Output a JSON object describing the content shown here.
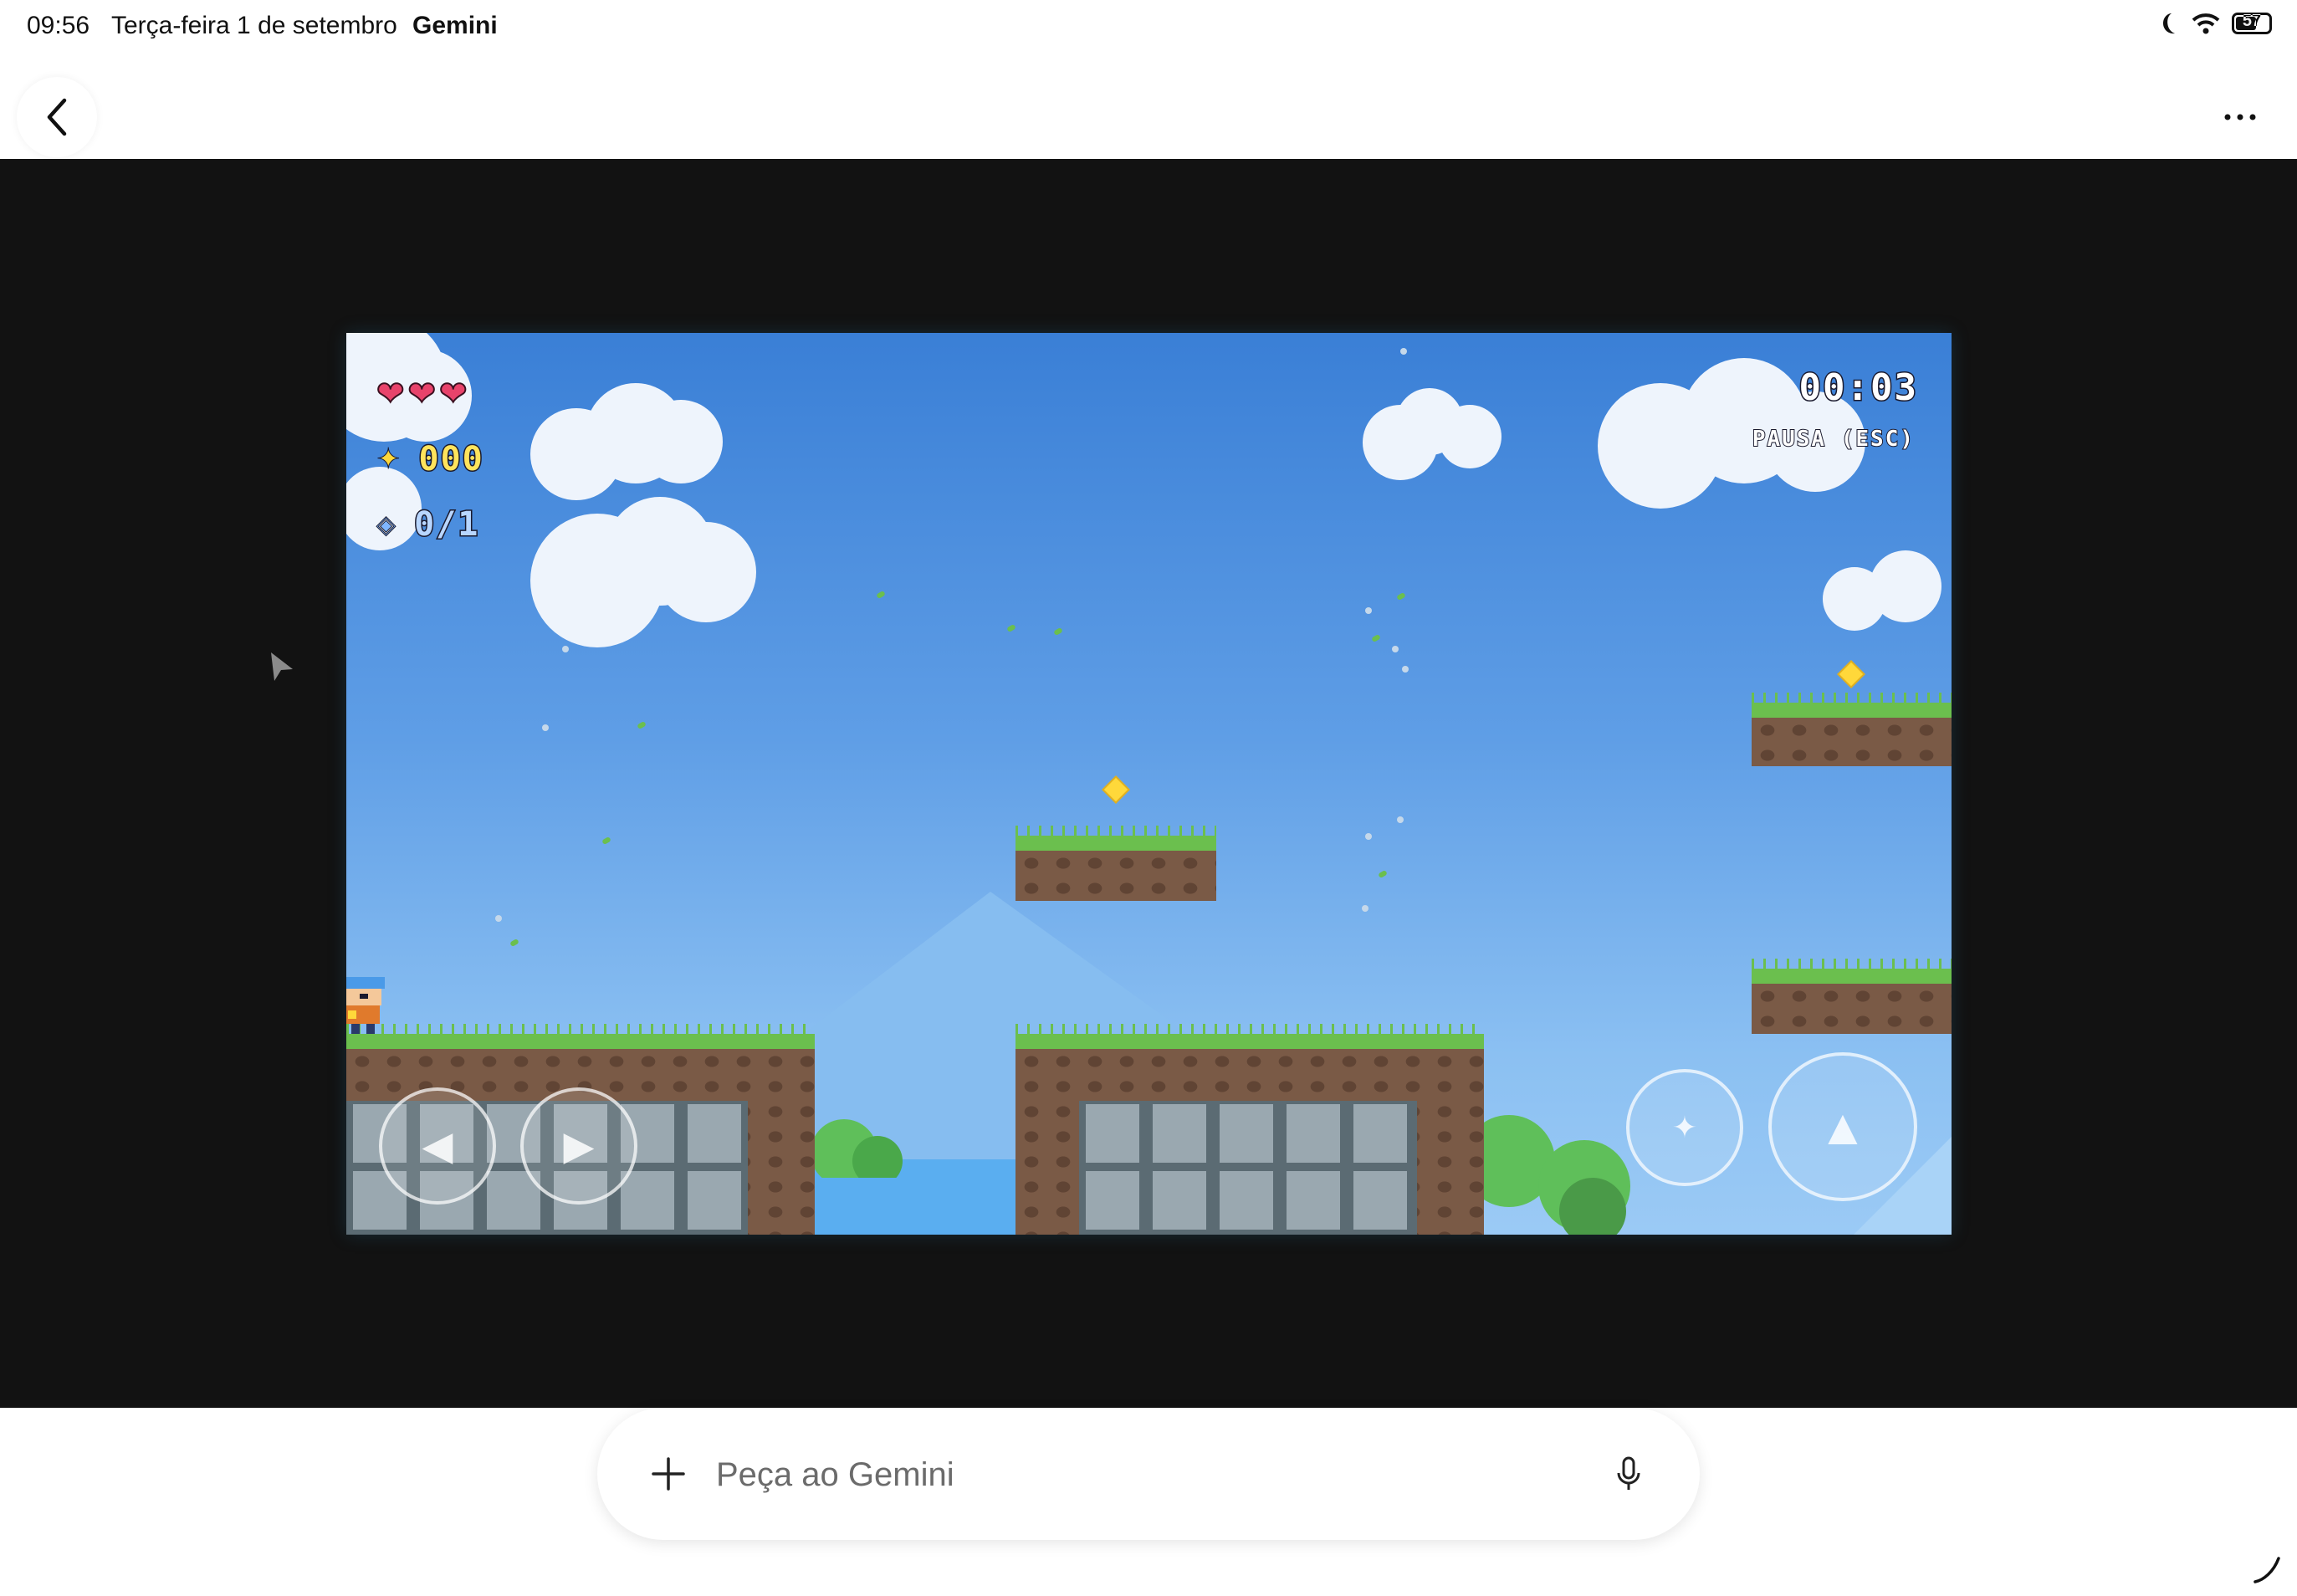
{
  "status_bar": {
    "time": "09:56",
    "date": "Terça-feira 1 de setembro",
    "app": "Gemini",
    "battery_level": "57"
  },
  "header": {
    "back_icon": "chevron-left-icon",
    "more_icon": "more-horizontal-icon"
  },
  "game": {
    "hearts": "❤❤❤",
    "coin_icon": "✦",
    "coins": "000",
    "gem_icon": "◈",
    "gems": "0/1",
    "timer": "00:03",
    "pause_hint": "PAUSA (ESC)",
    "controls": {
      "left": "◀",
      "right": "▶",
      "action": "✦",
      "jump": "▲"
    },
    "colors": {
      "sky_top": "#3a7fd6",
      "sky_bottom": "#9bcaf5",
      "grass": "#6bbf4e",
      "dirt": "#7a5a46",
      "coin": "#ffd83a",
      "heart": "#e8436b"
    }
  },
  "prompt": {
    "placeholder": "Peça ao Gemini",
    "plus_icon": "plus-icon",
    "mic_icon": "microphone-icon"
  }
}
